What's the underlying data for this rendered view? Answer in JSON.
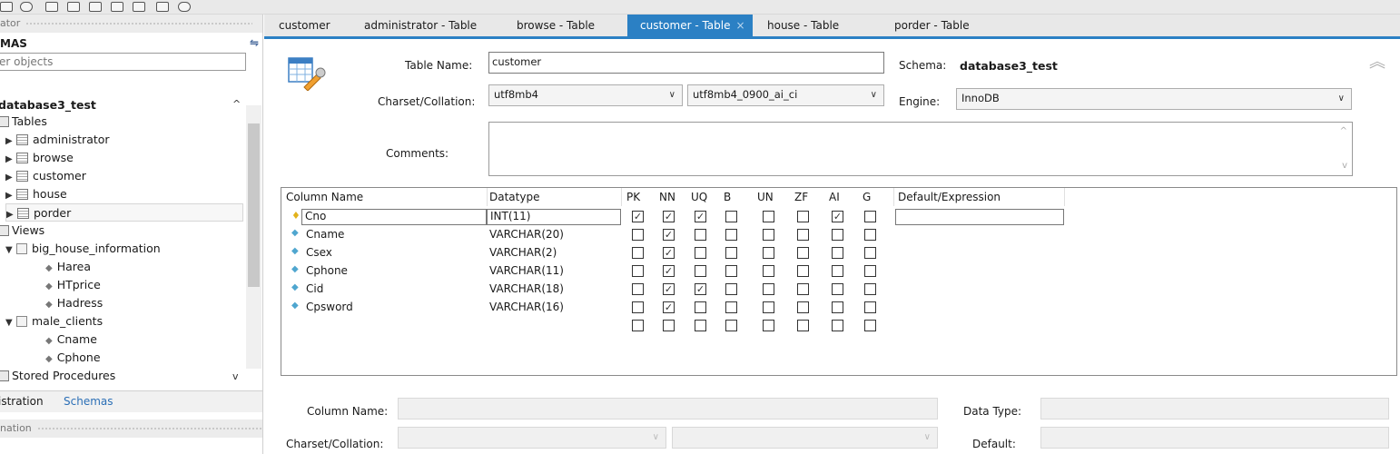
{
  "sidebar": {
    "navigator_title": "ator",
    "schemas_title": "MAS",
    "filter_placeholder": "er objects",
    "schema_name": "database3_test",
    "tree": {
      "tables_label": "Tables",
      "tables": [
        "administrator",
        "browse",
        "customer",
        "house",
        "porder"
      ],
      "views_label": "Views",
      "view1": "big_house_information",
      "view1_cols": [
        "Harea",
        "HTprice",
        "Hadress"
      ],
      "view2": "male_clients",
      "view2_cols": [
        "Cname",
        "Cphone"
      ],
      "procedures_label": "Stored Procedures"
    },
    "tabs": [
      "istration",
      "Schemas"
    ],
    "information_title": "nation"
  },
  "tabs": [
    "customer",
    "administrator - Table",
    "browse - Table",
    "customer - Table",
    "house - Table",
    "porder - Table"
  ],
  "tab_close": "×",
  "editor": {
    "table_name_label": "Table Name:",
    "table_name": "customer",
    "schema_label": "Schema:",
    "schema_value": "database3_test",
    "charset_label": "Charset/Collation:",
    "charset": "utf8mb4",
    "collation": "utf8mb4_0900_ai_ci",
    "engine_label": "Engine:",
    "engine": "InnoDB",
    "comments_label": "Comments:"
  },
  "grid": {
    "headers": [
      "Column Name",
      "Datatype",
      "PK",
      "NN",
      "UQ",
      "B",
      "UN",
      "ZF",
      "AI",
      "G",
      "Default/Expression"
    ],
    "rows": [
      {
        "name": "Cno",
        "type": "INT(11)",
        "flags": [
          true,
          true,
          true,
          false,
          false,
          false,
          true,
          false
        ]
      },
      {
        "name": "Cname",
        "type": "VARCHAR(20)",
        "flags": [
          false,
          true,
          false,
          false,
          false,
          false,
          false,
          false
        ]
      },
      {
        "name": "Csex",
        "type": "VARCHAR(2)",
        "flags": [
          false,
          true,
          false,
          false,
          false,
          false,
          false,
          false
        ]
      },
      {
        "name": "Cphone",
        "type": "VARCHAR(11)",
        "flags": [
          false,
          true,
          false,
          false,
          false,
          false,
          false,
          false
        ]
      },
      {
        "name": "Cid",
        "type": "VARCHAR(18)",
        "flags": [
          false,
          true,
          true,
          false,
          false,
          false,
          false,
          false
        ]
      },
      {
        "name": "Cpsword",
        "type": "VARCHAR(16)",
        "flags": [
          false,
          true,
          false,
          false,
          false,
          false,
          false,
          false
        ]
      }
    ]
  },
  "details": {
    "column_name_label": "Column Name:",
    "data_type_label": "Data Type:",
    "charset_label": "Charset/Collation:",
    "default_label": "Default:"
  }
}
